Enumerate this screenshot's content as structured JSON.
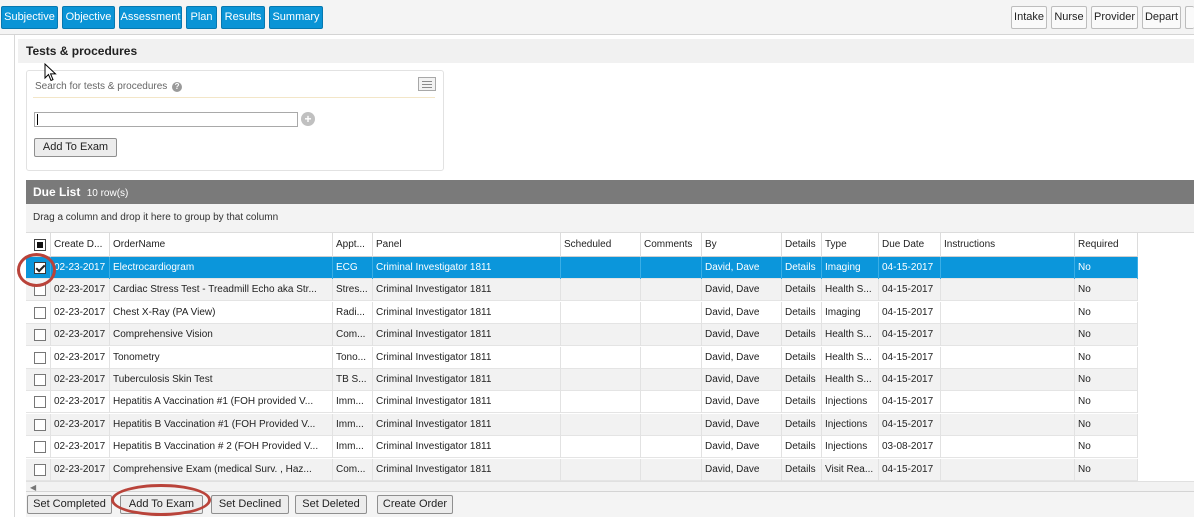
{
  "nav": {
    "tabs": [
      "Subjective",
      "Objective",
      "Assessment",
      "Plan",
      "Results",
      "Summary"
    ],
    "roles": [
      "Intake",
      "Nurse",
      "Provider",
      "Depart"
    ]
  },
  "section": {
    "title": "Tests & procedures"
  },
  "search": {
    "label": "Search for tests & procedures",
    "help_icon": "?",
    "value": "",
    "add_label": "Add To Exam"
  },
  "due_list": {
    "title": "Due List",
    "row_count": "10 row(s)",
    "group_hint": "Drag a column and drop it here to group by that column",
    "columns": [
      "Create D...",
      "OrderName",
      "Appt...",
      "Panel",
      "Scheduled",
      "Comments",
      "By",
      "Details",
      "Type",
      "Due Date",
      "Instructions",
      "Required"
    ],
    "rows": [
      {
        "checked": true,
        "selected": true,
        "cells": [
          "02-23-2017",
          "Electrocardiogram",
          "ECG",
          "Criminal Investigator 1811",
          "",
          "",
          "David, Dave",
          "Details",
          "Imaging",
          "04-15-2017",
          "",
          "No"
        ]
      },
      {
        "checked": false,
        "selected": false,
        "cells": [
          "02-23-2017",
          "Cardiac Stress Test - Treadmill Echo aka Str...",
          "Stres...",
          "Criminal Investigator 1811",
          "",
          "",
          "David, Dave",
          "Details",
          "Health S...",
          "04-15-2017",
          "",
          "No"
        ]
      },
      {
        "checked": false,
        "selected": false,
        "cells": [
          "02-23-2017",
          "Chest X-Ray (PA View)",
          "Radi...",
          "Criminal Investigator 1811",
          "",
          "",
          "David, Dave",
          "Details",
          "Imaging",
          "04-15-2017",
          "",
          "No"
        ]
      },
      {
        "checked": false,
        "selected": false,
        "cells": [
          "02-23-2017",
          "Comprehensive Vision",
          "Com...",
          "Criminal Investigator 1811",
          "",
          "",
          "David, Dave",
          "Details",
          "Health S...",
          "04-15-2017",
          "",
          "No"
        ]
      },
      {
        "checked": false,
        "selected": false,
        "cells": [
          "02-23-2017",
          "Tonometry",
          "Tono...",
          "Criminal Investigator 1811",
          "",
          "",
          "David, Dave",
          "Details",
          "Health S...",
          "04-15-2017",
          "",
          "No"
        ]
      },
      {
        "checked": false,
        "selected": false,
        "cells": [
          "02-23-2017",
          "Tuberculosis Skin Test",
          "TB S...",
          "Criminal Investigator 1811",
          "",
          "",
          "David, Dave",
          "Details",
          "Health S...",
          "04-15-2017",
          "",
          "No"
        ]
      },
      {
        "checked": false,
        "selected": false,
        "cells": [
          "02-23-2017",
          "Hepatitis A Vaccination #1 (FOH provided V...",
          "Imm...",
          "Criminal Investigator 1811",
          "",
          "",
          "David, Dave",
          "Details",
          "Injections",
          "04-15-2017",
          "",
          "No"
        ]
      },
      {
        "checked": false,
        "selected": false,
        "cells": [
          "02-23-2017",
          "Hepatitis B Vaccination #1 (FOH Provided V...",
          "Imm...",
          "Criminal Investigator 1811",
          "",
          "",
          "David, Dave",
          "Details",
          "Injections",
          "04-15-2017",
          "",
          "No"
        ]
      },
      {
        "checked": false,
        "selected": false,
        "cells": [
          "02-23-2017",
          "Hepatitis B Vaccination # 2 (FOH Provided V...",
          "Imm...",
          "Criminal Investigator 1811",
          "",
          "",
          "David, Dave",
          "Details",
          "Injections",
          "03-08-2017",
          "",
          "No"
        ]
      },
      {
        "checked": false,
        "selected": false,
        "cells": [
          "02-23-2017",
          "Comprehensive Exam (medical Surv. , Haz...",
          "Com...",
          "Criminal Investigator 1811",
          "",
          "",
          "David, Dave",
          "Details",
          "Visit Rea...",
          "04-15-2017",
          "",
          "No"
        ]
      }
    ]
  },
  "actions": [
    "Set Completed",
    "Add To Exam",
    "Set Declined",
    "Set Deleted",
    "Create Order"
  ],
  "colors": {
    "primary": "#0a94d6",
    "selected_row": "#0b96db",
    "header_bar": "#7a7a7a",
    "highlight_circle": "#b9433a"
  }
}
